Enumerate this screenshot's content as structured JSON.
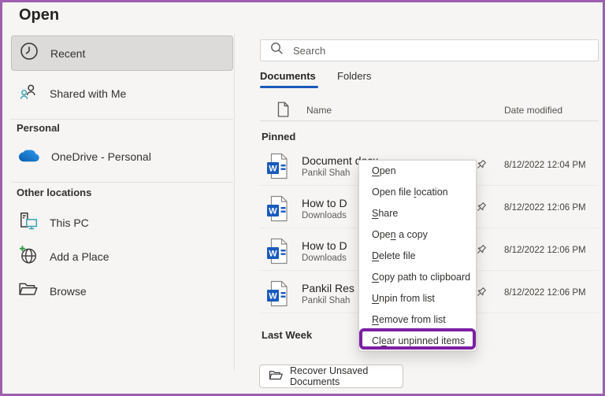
{
  "window": {
    "border_color": "#9e5fae",
    "background": "#f6f5f3"
  },
  "accent": {
    "tab_underline": "#185abd",
    "highlight_box": "#7c1fa2",
    "word_blue": "#185abd"
  },
  "page_title": "Open",
  "sidebar": {
    "recent": "Recent",
    "shared": "Shared with Me",
    "personal_section": "Personal",
    "onedrive": "OneDrive - Personal",
    "other_section": "Other locations",
    "this_pc": "This PC",
    "add_place": "Add a Place",
    "browse": "Browse"
  },
  "search": {
    "placeholder": "Search"
  },
  "tabs": {
    "documents": "Documents",
    "folders": "Folders"
  },
  "table": {
    "name": "Name",
    "date_modified": "Date modified"
  },
  "groups": {
    "pinned": "Pinned",
    "last_week": "Last Week"
  },
  "files": [
    {
      "name": "Document docx",
      "subtitle": "Pankil Shah",
      "date": "8/12/2022 12:04 PM"
    },
    {
      "name": "How to D",
      "subtitle": "Downloads",
      "date": "8/12/2022 12:06 PM"
    },
    {
      "name": "How to D",
      "subtitle": "Downloads",
      "date": "8/12/2022 12:06 PM"
    },
    {
      "name": "Pankil Res",
      "subtitle": "Pankil Shah",
      "date": "8/12/2022 12:06 PM"
    }
  ],
  "context_menu": {
    "items": [
      {
        "pre": "",
        "accel": "O",
        "post": "pen"
      },
      {
        "pre": "Open file ",
        "accel": "l",
        "post": "ocation"
      },
      {
        "pre": "",
        "accel": "S",
        "post": "hare"
      },
      {
        "pre": "Ope",
        "accel": "n",
        "post": " a copy"
      },
      {
        "pre": "",
        "accel": "D",
        "post": "elete file"
      },
      {
        "pre": "",
        "accel": "C",
        "post": "opy path to clipboard"
      },
      {
        "pre": "",
        "accel": "U",
        "post": "npin from list"
      },
      {
        "pre": "",
        "accel": "R",
        "post": "emove from list"
      },
      {
        "pre": "Cl",
        "accel": "e",
        "post": "ar unpinned items"
      }
    ]
  },
  "recover_button": {
    "label": "Recover Unsaved Documents"
  }
}
